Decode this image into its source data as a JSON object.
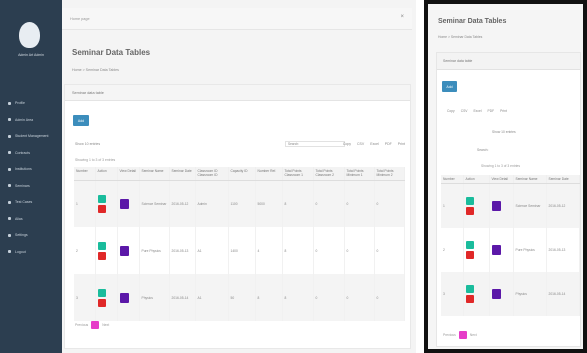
{
  "app": {
    "sidebar_user": "Admin Art Admin",
    "topbar_crumb": "Home page",
    "close_glyph": "×",
    "title": "Seminar Data Tables",
    "breadcrumb": "Home > Seminar Data Tables"
  },
  "sidebar": {
    "items": [
      {
        "label": "Profile",
        "icon": "user-icon"
      },
      {
        "label": "Admin Area",
        "icon": "dashboard-icon"
      },
      {
        "label": "Student Management",
        "icon": "users-icon"
      },
      {
        "label": "Contracts",
        "icon": "file-icon"
      },
      {
        "label": "Institutions",
        "icon": "building-icon"
      },
      {
        "label": "Seminars",
        "icon": "book-icon"
      },
      {
        "label": "Test Cases",
        "icon": "check-icon"
      },
      {
        "label": "Alias",
        "icon": "tag-icon"
      },
      {
        "label": "Settings",
        "icon": "gear-icon"
      },
      {
        "label": "Logout",
        "icon": "logout-icon"
      }
    ]
  },
  "panel": {
    "header": "Seminar data table",
    "add_label": "Add"
  },
  "toolbar": {
    "show_label": "Show 10 entries",
    "search_label": "Search:",
    "pager_labels": [
      "Copy",
      "CSV",
      "Excel",
      "PDF",
      "Print"
    ]
  },
  "showing": "Showing 1 to 3 of 3 entries",
  "table": {
    "columns": [
      "Number",
      "Action",
      "View Detail",
      "Seminar Name",
      "Seminar Date",
      "Classroom ID Classroom ID",
      "Capacity ID",
      "Number Ref.",
      "Total Points Classroom 1",
      "Total Points Classroom 2",
      "Total Points Minimum 1",
      "Total Points Minimum 2"
    ],
    "rows": [
      [
        "1",
        "",
        "",
        "Science Seminar",
        "2016-05-12",
        "Admin",
        "1100",
        "5000",
        "8",
        "0",
        "0",
        "0"
      ],
      [
        "2",
        "",
        "",
        "Pure Physics",
        "2016-05-13",
        "A1",
        "1400",
        "4",
        "8",
        "0",
        "0",
        "0"
      ],
      [
        "3",
        "",
        "",
        "Physics",
        "2016-05-14",
        "A1",
        "50",
        "8",
        "8",
        "0",
        "0",
        "0"
      ]
    ]
  },
  "pagination": {
    "prev": "Previous",
    "current": "1",
    "next": "Next"
  },
  "right_window": {
    "title": "Seminar Data Tables",
    "breadcrumb": "Home > Seminar Data Tables",
    "panel_header": "Seminar data table",
    "add_label": "Add",
    "tools": [
      "Copy",
      "CSV",
      "Excel",
      "PDF",
      "Print"
    ],
    "filter": "Show 10 entries",
    "search": "Search:",
    "showing": "Showing 1 to 3 of 3 entries",
    "columns": [
      "Number",
      "Action",
      "View Detail",
      "Seminar Name",
      "Seminar Date"
    ],
    "rows": [
      [
        "1",
        "Science Seminar",
        "2016-05-12"
      ],
      [
        "2",
        "Pure Physics",
        "2016-05-13"
      ],
      [
        "3",
        "Physics",
        "2016-05-14"
      ]
    ],
    "prev": "Previous",
    "next": "Next"
  },
  "colors": {
    "sidebar_bg": "#2c3e50",
    "primary": "#3c8dbc",
    "edit": "#1abc9c",
    "delete": "#e02828",
    "detail": "#5b18a8",
    "page_active": "#e63cc8"
  }
}
